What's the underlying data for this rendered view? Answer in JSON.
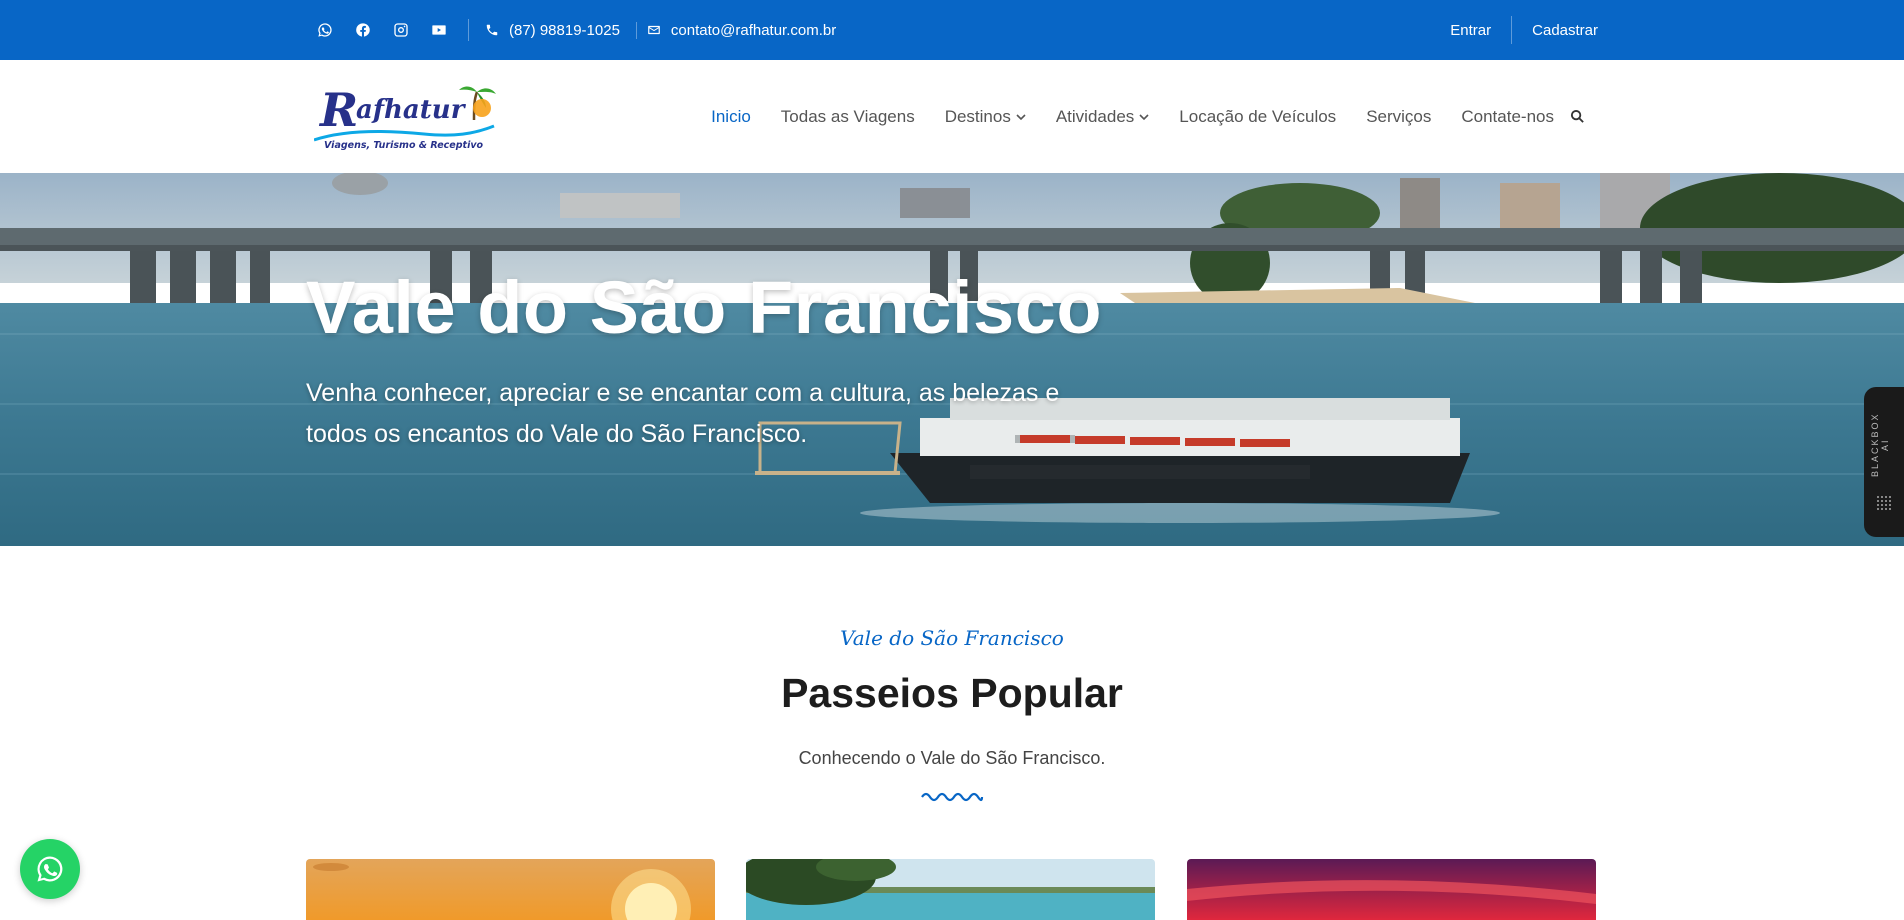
{
  "topbar": {
    "social": [
      "whatsapp-icon",
      "facebook-icon",
      "instagram-icon",
      "youtube-icon"
    ],
    "phone": "(87) 98819-1025",
    "email": "contato@rafhatur.com.br",
    "login": "Entrar",
    "register": "Cadastrar",
    "bg_color": "#0866c6"
  },
  "logo": {
    "name": "Rafhatur",
    "tagline": "Viagens, Turismo & Receptivo"
  },
  "nav": {
    "items": [
      {
        "label": "Inicio",
        "active": true
      },
      {
        "label": "Todas as Viagens"
      },
      {
        "label": "Destinos",
        "dropdown": true
      },
      {
        "label": "Atividades",
        "dropdown": true
      },
      {
        "label": "Locação de Veículos"
      },
      {
        "label": "Serviços"
      },
      {
        "label": "Contate-nos"
      }
    ],
    "search_icon": "search-icon",
    "active_color": "#0866c6"
  },
  "hero": {
    "title": "Vale do São Francisco",
    "subtitle": "Venha conhecer, apreciar e se encantar com a cultura, as belezas e todos os encantos do Vale do São Francisco."
  },
  "side_tab": {
    "label": "BLACKBOX AI"
  },
  "section": {
    "script_title": "Vale do São Francisco",
    "title": "Passeios Popular",
    "subtitle": "Conhecendo o Vale do São Francisco."
  },
  "floating": {
    "icon": "whatsapp-icon",
    "color": "#25d366"
  }
}
